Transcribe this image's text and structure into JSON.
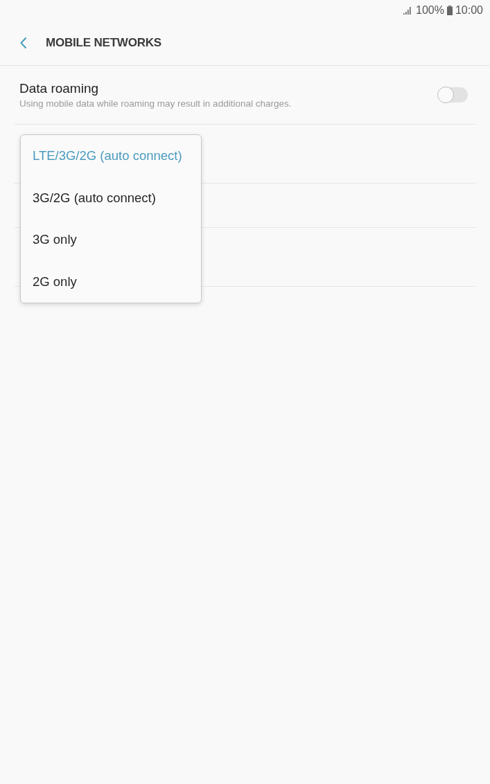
{
  "status_bar": {
    "battery": "100%",
    "time": "10:00"
  },
  "header": {
    "title": "MOBILE NETWORKS"
  },
  "settings": [
    {
      "kind": "toggle",
      "title": "Data roaming",
      "subtitle": "Using mobile data while roaming may result in additional charges.",
      "on": false
    }
  ],
  "dropdown": {
    "options": [
      {
        "label": "LTE/3G/2G (auto connect)",
        "selected": true
      },
      {
        "label": "3G/2G (auto connect)",
        "selected": false
      },
      {
        "label": "3G only",
        "selected": false
      },
      {
        "label": "2G only",
        "selected": false
      }
    ]
  }
}
